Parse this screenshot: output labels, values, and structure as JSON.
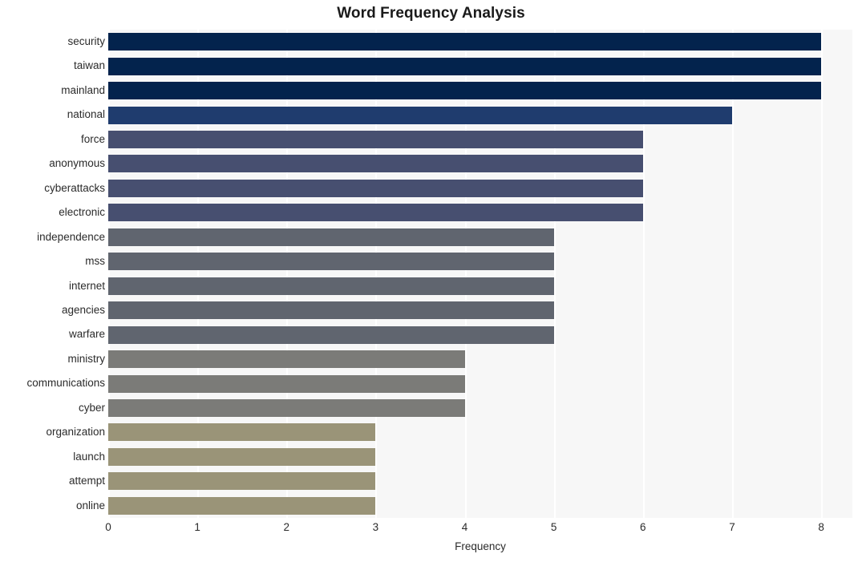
{
  "chart_data": {
    "type": "bar",
    "orientation": "horizontal",
    "title": "Word Frequency Analysis",
    "xlabel": "Frequency",
    "ylabel": "",
    "xlim": [
      0,
      8.35
    ],
    "ylim": [
      0,
      20
    ],
    "grid": true,
    "grid_axis": "x",
    "legend": false,
    "xticks": [
      "0",
      "1",
      "2",
      "3",
      "4",
      "5",
      "6",
      "7",
      "8"
    ],
    "xtick_values": [
      0,
      1,
      2,
      3,
      4,
      5,
      6,
      7,
      8
    ],
    "categories": [
      "security",
      "taiwan",
      "mainland",
      "national",
      "force",
      "anonymous",
      "cyberattacks",
      "electronic",
      "independence",
      "mss",
      "internet",
      "agencies",
      "warfare",
      "ministry",
      "communications",
      "cyber",
      "organization",
      "launch",
      "attempt",
      "online"
    ],
    "values": [
      8,
      8,
      8,
      7,
      6,
      6,
      6,
      6,
      5,
      5,
      5,
      5,
      5,
      4,
      4,
      4,
      3,
      3,
      3,
      3
    ],
    "bar_colors": [
      "#03234d",
      "#03234d",
      "#03234d",
      "#1f3c6e",
      "#474f70",
      "#474f70",
      "#474f70",
      "#474f70",
      "#60656f",
      "#60656f",
      "#60656f",
      "#60656f",
      "#60656f",
      "#7b7b78",
      "#7b7b78",
      "#7b7b78",
      "#9a9478",
      "#9a9478",
      "#9a9478",
      "#9a9478"
    ],
    "plot_background": "#f7f7f7",
    "grid_color": "#ffffff",
    "figure_background": "#ffffff",
    "text_color": "#2b2b2b"
  }
}
